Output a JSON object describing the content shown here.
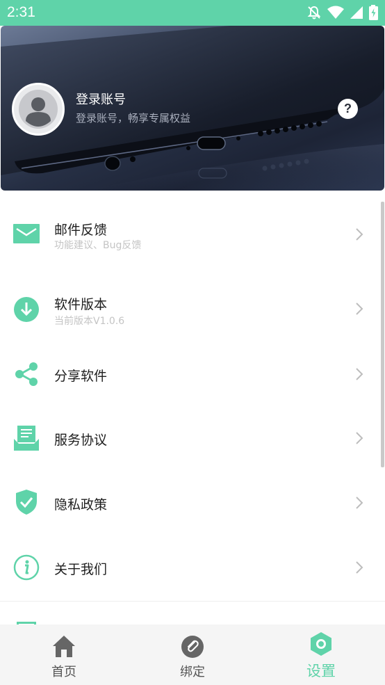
{
  "status_bar": {
    "time": "2:31"
  },
  "header": {
    "login_title": "登录账号",
    "login_subtitle": "登录账号，畅享专属权益",
    "help_symbol": "?"
  },
  "menu": {
    "items": [
      {
        "title": "邮件反馈",
        "subtitle": "功能建议、Bug反馈",
        "icon": "mail-icon"
      },
      {
        "title": "软件版本",
        "subtitle": "当前版本V1.0.6",
        "icon": "download-icon"
      },
      {
        "title": "分享软件",
        "subtitle": "",
        "icon": "share-icon"
      },
      {
        "title": "服务协议",
        "subtitle": "",
        "icon": "document-icon"
      },
      {
        "title": "隐私政策",
        "subtitle": "",
        "icon": "shield-check-icon"
      },
      {
        "title": "关于我们",
        "subtitle": "",
        "icon": "info-icon"
      }
    ]
  },
  "bottom_nav": {
    "items": [
      {
        "label": "首页",
        "icon": "home-icon",
        "active": false
      },
      {
        "label": "绑定",
        "icon": "link-icon",
        "active": false
      },
      {
        "label": "设置",
        "icon": "settings-hex-icon",
        "active": true
      }
    ]
  },
  "colors": {
    "accent": "#5fd3a9",
    "status_bar": "#5fd3a9",
    "nav_inactive": "#666666"
  }
}
